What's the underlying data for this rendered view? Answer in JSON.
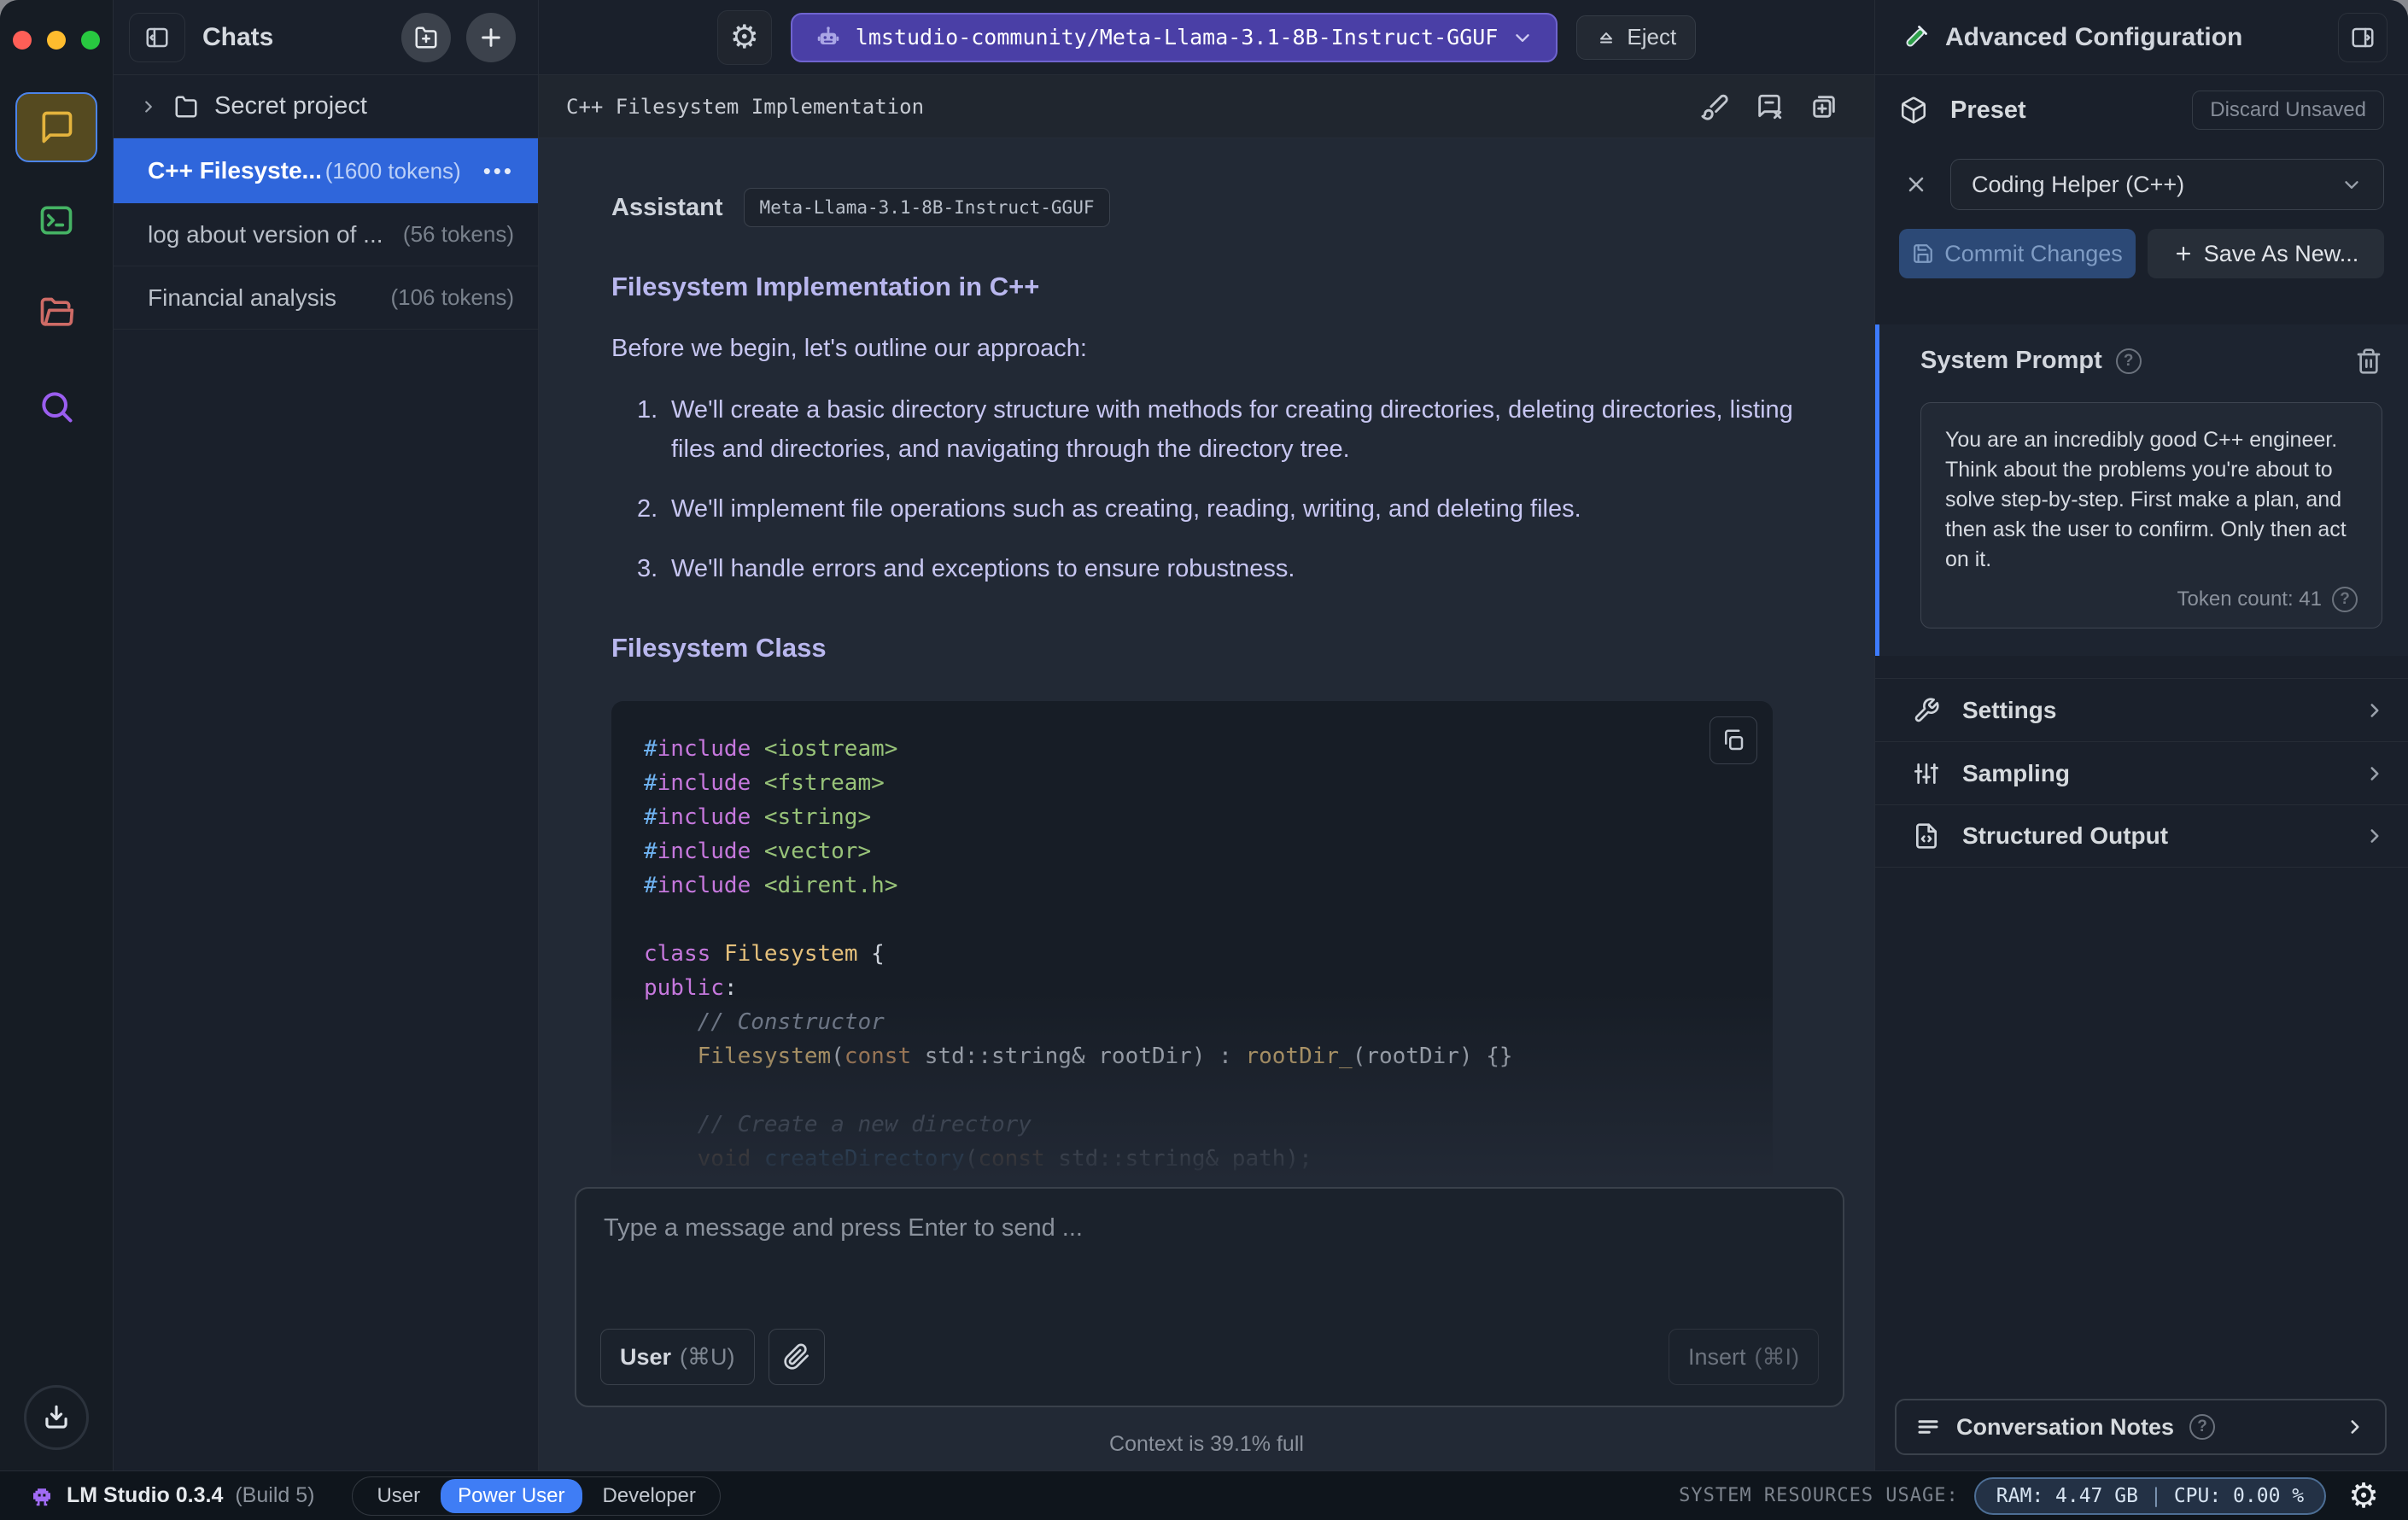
{
  "sidebar": {
    "title": "Chats",
    "folder": {
      "name": "Secret project"
    },
    "chats": [
      {
        "name": "C++ Filesyste...",
        "tokens": "(1600 tokens)",
        "menu_dots": "•••"
      },
      {
        "name": "log about version of ...",
        "tokens": "(56 tokens)"
      },
      {
        "name": "Financial analysis",
        "tokens": "(106 tokens)"
      }
    ]
  },
  "header": {
    "model_name": "lmstudio-community/Meta-Llama-3.1-8B-Instruct-GGUF",
    "eject_label": "Eject"
  },
  "chat": {
    "title": "C++ Filesystem Implementation",
    "message": {
      "role": "Assistant",
      "model_badge": "Meta-Llama-3.1-8B-Instruct-GGUF",
      "heading_1": "Filesystem Implementation in C++",
      "intro": "Before we begin, let's outline our approach:",
      "list_numbers": [
        "1.",
        "2.",
        "3."
      ],
      "list": [
        "We'll create a basic directory structure with methods for creating directories, deleting directories, listing files and directories, and navigating through the directory tree.",
        "We'll implement file operations such as creating, reading, writing, and deleting files.",
        "We'll handle errors and exceptions to ensure robustness."
      ],
      "heading_2": "Filesystem Class",
      "code_lines": [
        [
          [
            "hash",
            "#"
          ],
          [
            "kw",
            "include"
          ],
          [
            "pun",
            " "
          ],
          [
            "str",
            "<iostream>"
          ]
        ],
        [
          [
            "hash",
            "#"
          ],
          [
            "kw",
            "include"
          ],
          [
            "pun",
            " "
          ],
          [
            "str",
            "<fstream>"
          ]
        ],
        [
          [
            "hash",
            "#"
          ],
          [
            "kw",
            "include"
          ],
          [
            "pun",
            " "
          ],
          [
            "str",
            "<string>"
          ]
        ],
        [
          [
            "hash",
            "#"
          ],
          [
            "kw",
            "include"
          ],
          [
            "pun",
            " "
          ],
          [
            "str",
            "<vector>"
          ]
        ],
        [
          [
            "hash",
            "#"
          ],
          [
            "kw",
            "include"
          ],
          [
            "pun",
            " "
          ],
          [
            "str",
            "<dirent.h>"
          ]
        ],
        [],
        [
          [
            "kw",
            "class"
          ],
          [
            "pun",
            " "
          ],
          [
            "type",
            "Filesystem"
          ],
          [
            "pun",
            " {"
          ]
        ],
        [
          [
            "kw",
            "public"
          ],
          [
            "pun",
            ":"
          ]
        ],
        [
          [
            "cmt",
            "    // Constructor"
          ]
        ],
        [
          [
            "pun",
            "    "
          ],
          [
            "type",
            "Filesystem"
          ],
          [
            "pun",
            "("
          ],
          [
            "const",
            "const"
          ],
          [
            "pun",
            " std::string& rootDir) : "
          ],
          [
            "type",
            "rootDir_"
          ],
          [
            "pun",
            "(rootDir) {}"
          ]
        ],
        [],
        [
          [
            "cmt",
            "    // Create a new directory"
          ]
        ],
        [
          [
            "pun",
            "    "
          ],
          [
            "const",
            "void"
          ],
          [
            "pun",
            " "
          ],
          [
            "fn",
            "createDirectory"
          ],
          [
            "pun",
            "("
          ],
          [
            "const",
            "const"
          ],
          [
            "pun",
            " std::string& path);"
          ]
        ]
      ]
    }
  },
  "composer": {
    "placeholder": "Type a message and press Enter to send ...",
    "role_button": "User",
    "role_shortcut": "(⌘U)",
    "insert_label": "Insert",
    "insert_shortcut": "(⌘I)",
    "context_status": "Context is 39.1% full"
  },
  "config_panel": {
    "title": "Advanced Configuration",
    "preset": {
      "label": "Preset",
      "discard_label": "Discard Unsaved",
      "selected": "Coding Helper (C++)",
      "commit_label": "Commit Changes",
      "save_as_label": "Save As New..."
    },
    "system_prompt": {
      "label": "System Prompt",
      "help": "?",
      "text": "You are an incredibly good C++ engineer. Think about the problems you're about to solve step-by-step. First make a plan, and then ask the user to confirm. Only then act on it.",
      "token_count": "Token count: 41"
    },
    "sections": [
      {
        "label": "Settings"
      },
      {
        "label": "Sampling"
      },
      {
        "label": "Structured Output"
      }
    ],
    "notes_label": "Conversation Notes"
  },
  "status_bar": {
    "app_name": "LM Studio 0.3.4",
    "build": "(Build 5)",
    "modes": [
      "User",
      "Power User",
      "Developer"
    ],
    "resources_label": "SYSTEM RESOURCES USAGE:",
    "ram": "RAM: 4.47 GB",
    "divider": "|",
    "cpu": "CPU: 0.00 %"
  },
  "colors": {
    "selected_chat_blue": "#2f66db",
    "model_pill_purple": "#4a3fa6",
    "active_mode_blue": "#3f7df5",
    "system_prompt_accent": "#3d7bfd",
    "assistant_text_lavender": "#c7c6f1"
  }
}
